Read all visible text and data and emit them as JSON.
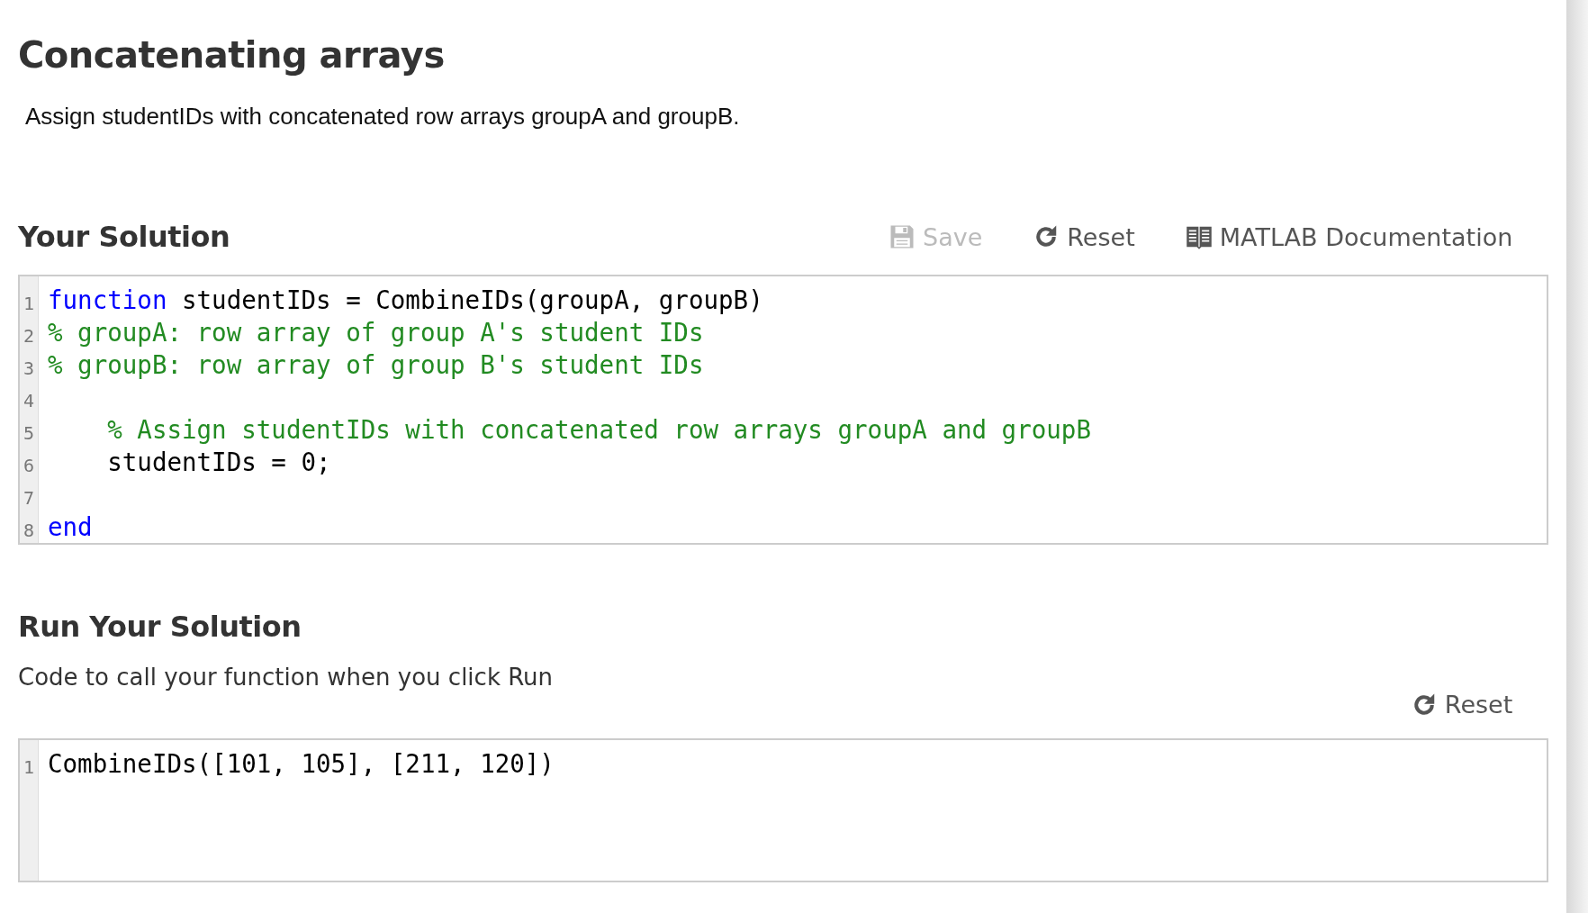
{
  "title": "Concatenating arrays",
  "description": "Assign studentIDs with concatenated row arrays groupA and groupB.",
  "solution": {
    "heading": "Your Solution",
    "actions": [
      {
        "kind": "save",
        "label": "Save",
        "disabled": true
      },
      {
        "kind": "reset",
        "label": "Reset",
        "disabled": false
      },
      {
        "kind": "docs",
        "label": "MATLAB Documentation",
        "disabled": false
      }
    ],
    "editor": [
      {
        "number": "1",
        "tokens": [
          {
            "kind": "keyword",
            "text": "function"
          },
          {
            "kind": "plain",
            "text": " studentIDs = CombineIDs(groupA, groupB)"
          }
        ]
      },
      {
        "number": "2",
        "tokens": [
          {
            "kind": "comment",
            "text": "% groupA: row array of group A's student IDs"
          }
        ]
      },
      {
        "number": "3",
        "tokens": [
          {
            "kind": "comment",
            "text": "% groupB: row array of group B's student IDs"
          }
        ]
      },
      {
        "number": "4"
      },
      {
        "number": "5",
        "indent": true,
        "tokens": [
          {
            "kind": "comment",
            "text": "% Assign studentIDs with concatenated row arrays groupA and groupB"
          }
        ]
      },
      {
        "number": "6",
        "indent": true,
        "tokens": [
          {
            "kind": "plain",
            "text": "studentIDs = 0;"
          }
        ]
      },
      {
        "number": "7"
      },
      {
        "number": "8",
        "tokens": [
          {
            "kind": "keyword",
            "text": "end"
          }
        ]
      }
    ]
  },
  "run": {
    "heading": "Run Your Solution",
    "hint": "Code to call your function when you click Run",
    "actions": [
      {
        "kind": "reset",
        "label": "Reset",
        "disabled": false
      }
    ],
    "editor": [
      {
        "number": "1",
        "tokens": [
          {
            "kind": "plain",
            "text": "CombineIDs([101, 105], [211, 120])"
          }
        ]
      }
    ]
  }
}
